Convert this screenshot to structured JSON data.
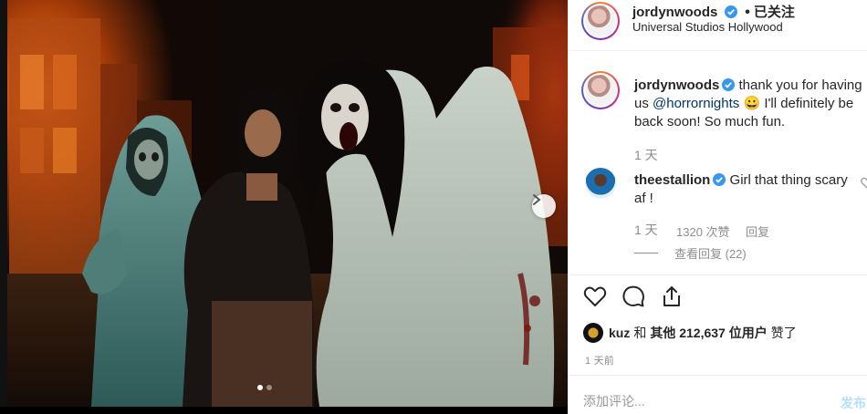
{
  "post": {
    "username": "jordynwoods",
    "follow_separator": "•",
    "follow_status": "已关注",
    "location": "Universal Studios Hollywood",
    "verified": true
  },
  "caption": {
    "username": "jordynwoods",
    "text_before": "thank you for having us ",
    "mention": "@horrornights",
    "emoji": "😀",
    "text_after": " I'll definitely be back soon! So much fun.",
    "time": "1 天"
  },
  "reply": {
    "username": "theestallion",
    "text": "Girl that thing scary af !",
    "time": "1 天",
    "likes": "1320 次赞",
    "reply_label": "回复",
    "view_replies": "查看回复 (22)"
  },
  "likes": {
    "name": "kuz",
    "and": "和",
    "others": "其他 212,637 位用户",
    "liked": "赞了"
  },
  "posted_ago": "1 天前",
  "comment_box": {
    "placeholder": "添加评论...",
    "post_label": "发布"
  },
  "carousel": {
    "total": 2,
    "current": 1
  },
  "colors": {
    "link": "#003569",
    "verified": "#3897f0",
    "muted": "#8e8e8e"
  },
  "icons": [
    "heart-icon",
    "comment-icon",
    "share-icon",
    "chevron-right-icon",
    "verified-icon",
    "heart-outline-icon"
  ]
}
